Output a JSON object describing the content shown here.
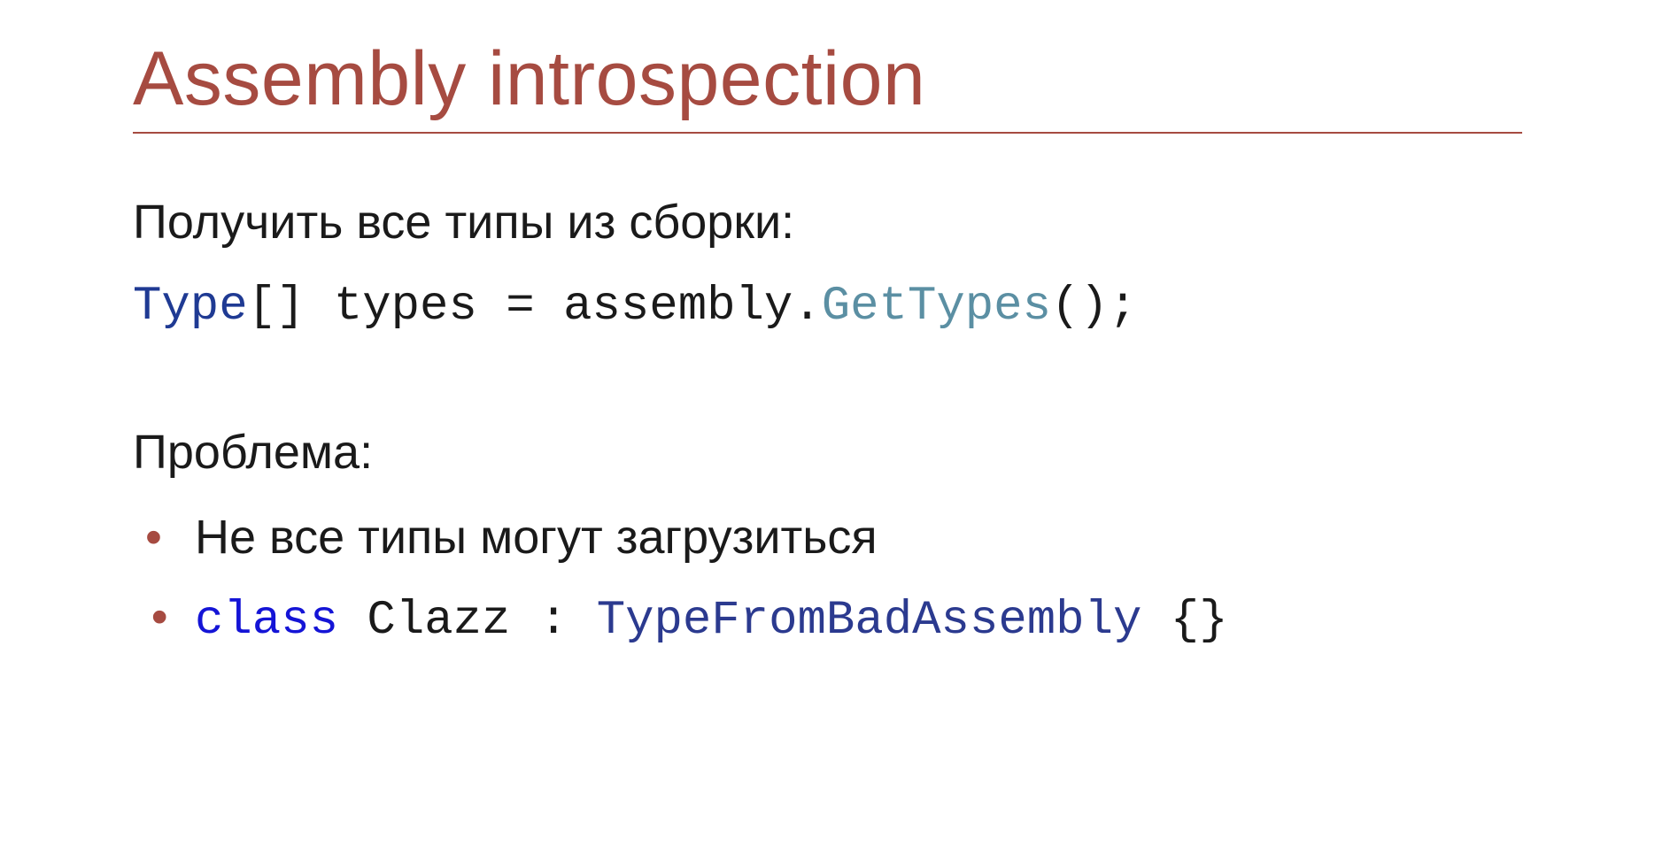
{
  "title": "Assembly introspection",
  "section1": {
    "heading": "Получить все типы из сборки:",
    "code": {
      "t1": "Type",
      "t2": "[] types = assembly.",
      "t3": "GetTypes",
      "t4": "();"
    }
  },
  "section2": {
    "heading": "Проблема:",
    "bullets": {
      "b1": "Не все типы могут загрузиться",
      "b2": {
        "p1": "class",
        "p2": " Clazz : ",
        "p3": "TypeFromBadAssembly",
        "p4": " {}"
      }
    }
  }
}
